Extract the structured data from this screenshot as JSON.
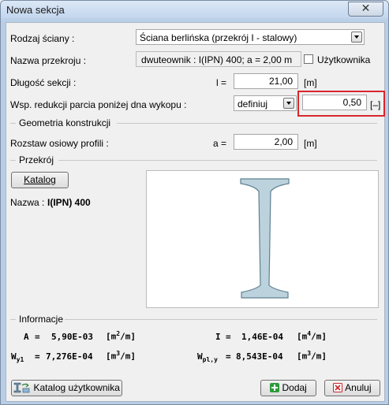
{
  "window": {
    "title": "Nowa sekcja",
    "close_glyph": "✕"
  },
  "form": {
    "wall_type_label": "Rodzaj ściany :",
    "wall_type_value": "Ściana berlińska (przekrój I - stalowy)",
    "section_name_label": "Nazwa przekroju :",
    "section_name_value": "dwuteownik : I(IPN) 400; a = 2,00 m",
    "user_checkbox_label": "Użytkownika",
    "length_label": "Długość sekcji :",
    "length_symbol": "l =",
    "length_value": "21,00",
    "length_unit": "[m]",
    "reduction_label": "Wsp. redukcji parcia poniżej dna wykopu :",
    "reduction_mode": "definiuj",
    "reduction_value": "0,50",
    "reduction_unit": "[–]"
  },
  "geometry": {
    "legend": "Geometria konstrukcji",
    "spacing_label": "Rozstaw osiowy profili :",
    "spacing_symbol": "a =",
    "spacing_value": "2,00",
    "spacing_unit": "[m]"
  },
  "section": {
    "legend": "Przekrój",
    "catalog_button": "Katalog",
    "name_label": "Nazwa :",
    "name_value": "I(IPN) 400"
  },
  "info": {
    "legend": "Informacje",
    "A_symbol": "A",
    "A_value": "5,90E-03",
    "A_unit_base": "[m",
    "A_unit_exp": "2",
    "A_unit_tail": "/m]",
    "I_symbol": "I",
    "I_value": "1,46E-04",
    "I_unit_base": "[m",
    "I_unit_exp": "4",
    "I_unit_tail": "/m]",
    "Wy1_symbol": "W",
    "Wy1_sub": "y1",
    "Wy1_value": "7,276E-04",
    "Wy1_unit_base": "[m",
    "Wy1_unit_exp": "3",
    "Wy1_unit_tail": "/m]",
    "Wply_symbol": "W",
    "Wply_sub": "pl,y",
    "Wply_value": "8,543E-04",
    "Wply_unit_base": "[m",
    "Wply_unit_exp": "3",
    "Wply_unit_tail": "/m]",
    "equals": "="
  },
  "buttons": {
    "user_catalog": "Katalog użytkownika",
    "add": "Dodaj",
    "cancel": "Anuluj"
  },
  "colors": {
    "highlight": "#d9262c",
    "profile_fill": "#bcd3de",
    "profile_stroke": "#5f7f8f",
    "add_icon": "#2e9a3a",
    "cancel_icon": "#c9262a"
  },
  "icons": {
    "close": "close-icon",
    "add": "plus-icon",
    "cancel": "x-icon",
    "user_catalog": "catalog-profile-icon",
    "dropdown": "chevron-down-icon"
  }
}
